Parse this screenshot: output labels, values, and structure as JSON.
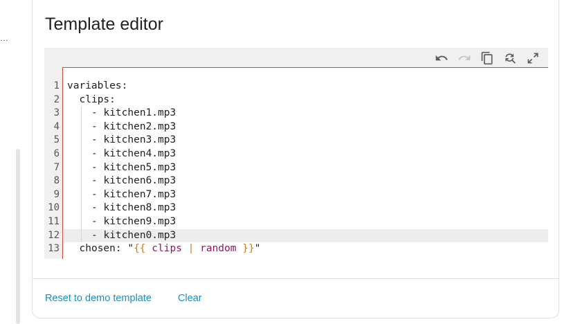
{
  "left": {
    "overflow_text": "…"
  },
  "card": {
    "title": "Template editor"
  },
  "toolbar": {
    "undo_icon": "undo-icon",
    "redo_icon": "redo-icon",
    "copy_icon": "copy-icon",
    "find_replace_icon": "find-replace-icon",
    "fullscreen_icon": "fullscreen-icon"
  },
  "editor": {
    "lines": [
      {
        "num": "1",
        "indent": 0,
        "text": "variables:"
      },
      {
        "num": "2",
        "indent": 1,
        "text": "clips:"
      },
      {
        "num": "3",
        "indent": 2,
        "text": "- kitchen1.mp3"
      },
      {
        "num": "4",
        "indent": 2,
        "text": "- kitchen2.mp3"
      },
      {
        "num": "5",
        "indent": 2,
        "text": "- kitchen3.mp3"
      },
      {
        "num": "6",
        "indent": 2,
        "text": "- kitchen4.mp3"
      },
      {
        "num": "7",
        "indent": 2,
        "text": "- kitchen5.mp3"
      },
      {
        "num": "8",
        "indent": 2,
        "text": "- kitchen6.mp3"
      },
      {
        "num": "9",
        "indent": 2,
        "text": "- kitchen7.mp3"
      },
      {
        "num": "10",
        "indent": 2,
        "text": "- kitchen8.mp3"
      },
      {
        "num": "11",
        "indent": 2,
        "text": "- kitchen9.mp3"
      },
      {
        "num": "12",
        "indent": 2,
        "text": "- kitchen0.mp3",
        "active": true
      },
      {
        "num": "13",
        "indent": 1,
        "key": "chosen: \"",
        "tpl_open": "{{",
        "tpl_var": " clips ",
        "tpl_pipe": "|",
        "tpl_filter": " random ",
        "tpl_close": "}}",
        "tail": "\""
      }
    ]
  },
  "actions": {
    "reset_label": "Reset to demo template",
    "clear_label": "Clear"
  },
  "colors": {
    "accent": "#1b8ec2",
    "cursor_border": "#d94b3c",
    "template_brace": "#c77d2a",
    "template_var": "#8a1a5e"
  }
}
